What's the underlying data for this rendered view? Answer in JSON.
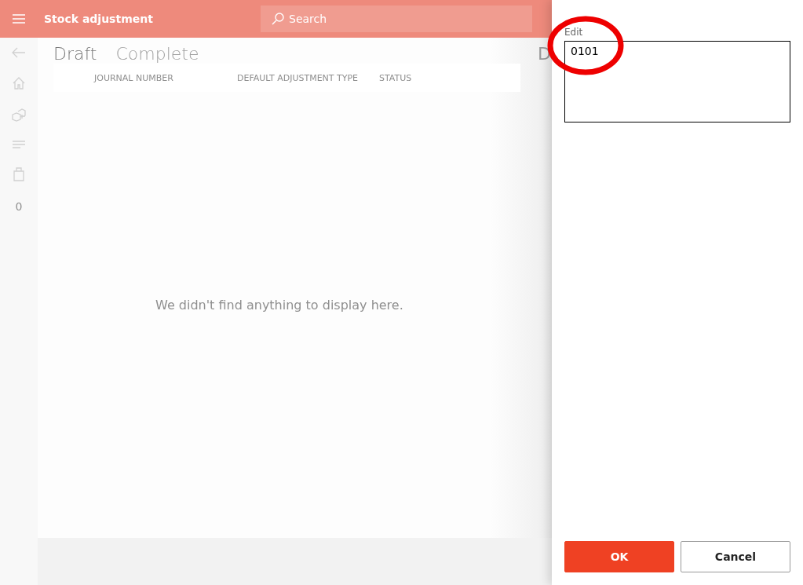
{
  "header": {
    "title": "Stock adjustment",
    "search": {
      "placeholder": "Search"
    }
  },
  "nav": [
    {
      "kind": "back"
    },
    {
      "kind": "home"
    },
    {
      "kind": "boxes"
    },
    {
      "kind": "lines"
    },
    {
      "kind": "bag"
    },
    {
      "kind": "count",
      "label": "0"
    }
  ],
  "tabs": [
    {
      "label": "Draft",
      "selected": true
    },
    {
      "label": "Complete",
      "selected": false
    }
  ],
  "cut_text": "D",
  "table": {
    "columns": [
      "JOURNAL NUMBER",
      "DEFAULT ADJUSTMENT TYPE",
      "STATUS"
    ],
    "empty_message": "We didn't find anything to display here."
  },
  "panel": {
    "field": {
      "label": "Edit",
      "value": "0101"
    },
    "buttons": [
      {
        "label": "OK",
        "kind": "primary"
      },
      {
        "label": "Cancel",
        "kind": "secondary"
      }
    ]
  }
}
